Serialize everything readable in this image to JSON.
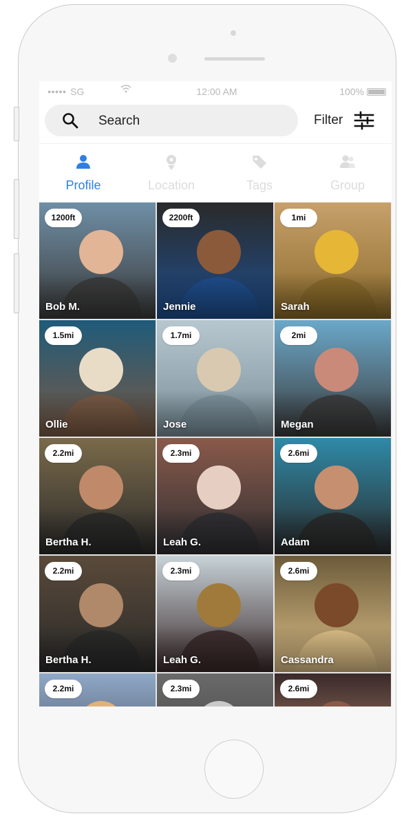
{
  "status_bar": {
    "carrier": "SG",
    "time": "12:00 AM",
    "battery": "100%"
  },
  "search": {
    "label": "Search"
  },
  "filter": {
    "label": "Filter"
  },
  "tabs": [
    {
      "label": "Profile",
      "icon": "user-icon",
      "active": true
    },
    {
      "label": "Location",
      "icon": "location-pin-icon",
      "active": false
    },
    {
      "label": "Tags",
      "icon": "tag-icon",
      "active": false
    },
    {
      "label": "Group",
      "icon": "group-icon",
      "active": false
    }
  ],
  "colors": {
    "accent": "#2f7fe3",
    "inactive_tab": "#dcdcdc"
  },
  "people": [
    {
      "distance": "1200ft",
      "name": "Bob M."
    },
    {
      "distance": "2200ft",
      "name": "Jennie"
    },
    {
      "distance": "1mi",
      "name": "Sarah"
    },
    {
      "distance": "1.5mi",
      "name": "Ollie"
    },
    {
      "distance": "1.7mi",
      "name": "Jose"
    },
    {
      "distance": "2mi",
      "name": "Megan"
    },
    {
      "distance": "2.2mi",
      "name": "Bertha H."
    },
    {
      "distance": "2.3mi",
      "name": "Leah G."
    },
    {
      "distance": "2.6mi",
      "name": "Adam"
    },
    {
      "distance": "2.2mi",
      "name": "Bertha H."
    },
    {
      "distance": "2.3mi",
      "name": "Leah G."
    },
    {
      "distance": "2.6mi",
      "name": "Cassandra"
    },
    {
      "distance": "2.2mi",
      "name": ""
    },
    {
      "distance": "2.3mi",
      "name": ""
    },
    {
      "distance": "2.6mi",
      "name": ""
    }
  ]
}
